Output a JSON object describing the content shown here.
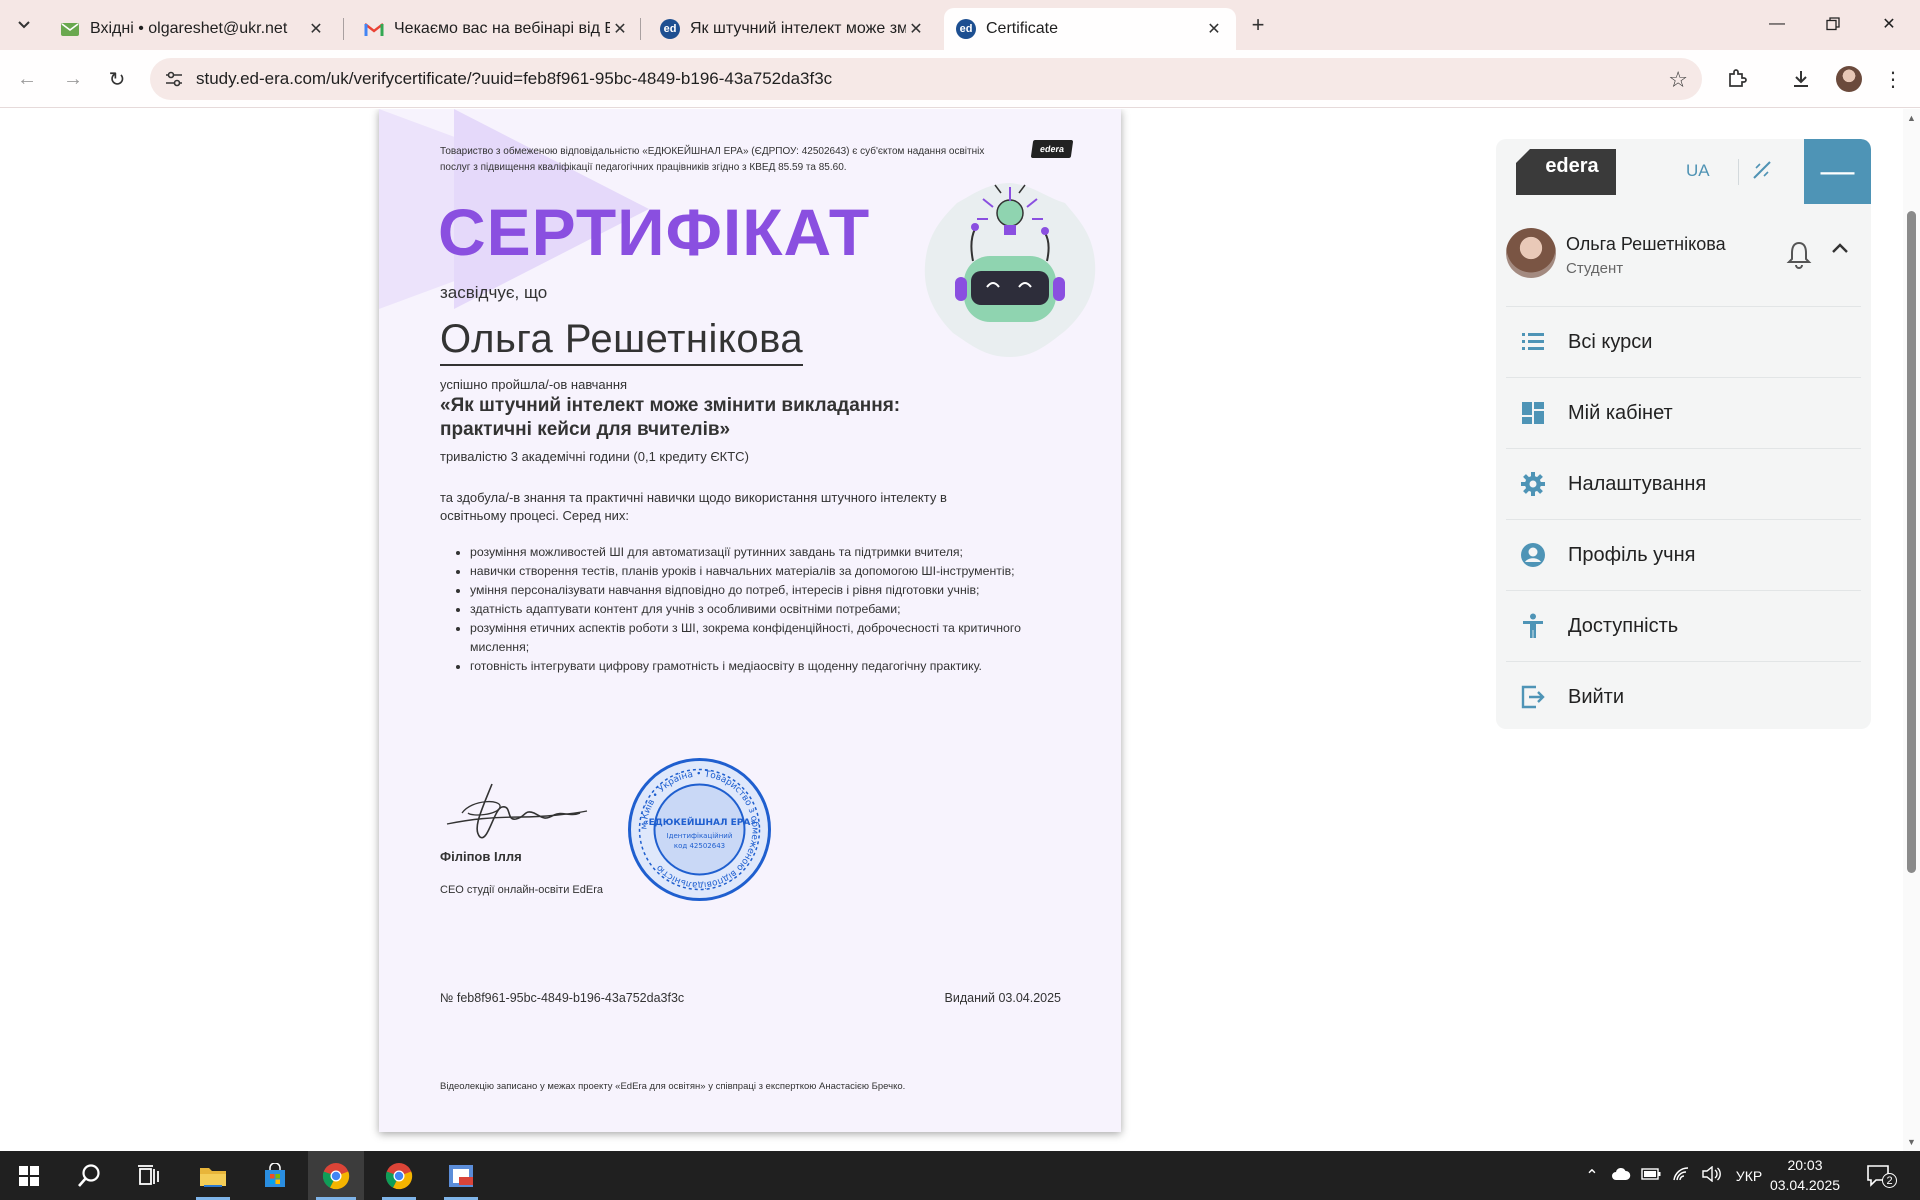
{
  "browser": {
    "tabs": [
      {
        "title": "Вхідні • olgareshet@ukr.net",
        "favicon": "ukrnet-mail-icon"
      },
      {
        "title": "Чекаємо вас на вебінарі від EdEra",
        "favicon": "gmail-icon"
      },
      {
        "title": "Як штучний інтелект може змінити",
        "favicon": "edera-icon"
      },
      {
        "title": "Certificate",
        "favicon": "edera-icon"
      }
    ],
    "active_tab": 3,
    "address": "study.ed-era.com/uk/verifycertificate/?uuid=feb8f961-95bc-4849-b196-43a752da3f3c",
    "favicon_text": "ed"
  },
  "certificate": {
    "legal_text": "Товариство з обмеженою відповідальністю «ЕДЮКЕЙШНАЛ ЕРА» (ЄДРПОУ: 42502643) є суб'єктом надання освітніх послуг з підвищення кваліфікації педагогічних працівників згідно з КВЕД 85.59 та 85.60.",
    "logo": "edera",
    "title": "СЕРТИФІКАТ",
    "certifies": "засвідчує, що",
    "name": "Ольга Решетнікова",
    "passed": "успішно пройшла/-ов навчання",
    "course": "«Як штучний інтелект може змінити викладання: практичні кейси для вчителів»",
    "duration": "тривалістю 3 академічні години (0,1 кредиту ЄКТС)",
    "acquired": "та здобула/-в знання та практичні навички щодо використання штучного інтелекту в освітньому процесі. Серед них:",
    "skills": [
      "розуміння можливостей ШІ для автоматизації рутинних завдань та підтримки вчителя;",
      "навички створення тестів, планів уроків і навчальних матеріалів за допомогою ШІ-інструментів;",
      "уміння персоналізувати навчання відповідно до потреб, інтересів і рівня підготовки учнів;",
      "здатність адаптувати контент для учнів з особливими освітніми потребами;",
      "розуміння етичних аспектів роботи з ШІ, зокрема конфіденційності, доброчесності та критичного мислення;",
      "готовність інтегрувати цифрову грамотність і медіаосвіту в щоденну педагогічну практику."
    ],
    "signer_name": "Філіпов Ілля",
    "signer_role": "CEO студії онлайн-освіти EdEra",
    "stamp": {
      "name": "«ЕДЮКЕЙШНАЛ ЕРА»",
      "subtitle": "Ідентифікаційний",
      "code": "код 42502643",
      "ring": "м.Київ • Україна • Товариство з обмеженою відповідальністю"
    },
    "number": "№ feb8f961-95bc-4849-b196-43a752da3f3c",
    "issued": "Виданий 03.04.2025",
    "footer": "Відеолекцію записано у межах проекту «EdEra для освітян» у співпраці з експерткою Анастасією Бречко."
  },
  "menu": {
    "logo": "edera",
    "lang": "UA",
    "user_name": "Ольга Решетнікова",
    "user_role": "Студент",
    "items": [
      {
        "label": "Всі курси",
        "icon": "list-icon"
      },
      {
        "label": "Мій кабінет",
        "icon": "dashboard-icon"
      },
      {
        "label": "Налаштування",
        "icon": "gear-icon"
      },
      {
        "label": "Профіль учня",
        "icon": "account-icon"
      },
      {
        "label": "Доступність",
        "icon": "accessibility-icon"
      },
      {
        "label": "Вийти",
        "icon": "logout-icon"
      }
    ]
  },
  "taskbar": {
    "lang": "УКР",
    "time": "20:03",
    "date": "03.04.2025",
    "notifications": "2"
  },
  "colors": {
    "accent_purple": "#8a4fe0",
    "menu_blue": "#4e94b6",
    "tabstrip": "#f5e7e5"
  }
}
